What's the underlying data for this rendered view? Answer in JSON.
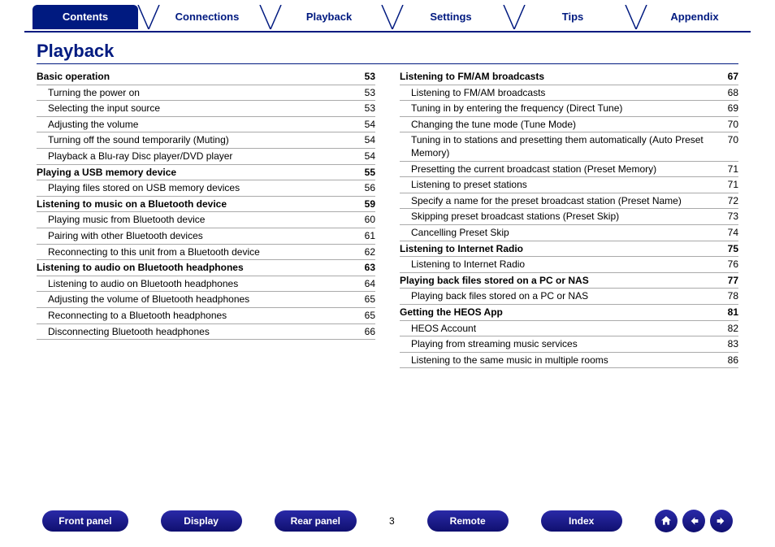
{
  "tabs": [
    {
      "label": "Contents",
      "active": true
    },
    {
      "label": "Connections",
      "active": false
    },
    {
      "label": "Playback",
      "active": false
    },
    {
      "label": "Settings",
      "active": false
    },
    {
      "label": "Tips",
      "active": false
    },
    {
      "label": "Appendix",
      "active": false
    }
  ],
  "heading": "Playback",
  "left": [
    {
      "label": "Basic operation",
      "page": "53",
      "section": true
    },
    {
      "label": "Turning the power on",
      "page": "53",
      "section": false
    },
    {
      "label": "Selecting the input source",
      "page": "53",
      "section": false
    },
    {
      "label": "Adjusting the volume",
      "page": "54",
      "section": false
    },
    {
      "label": "Turning off the sound temporarily (Muting)",
      "page": "54",
      "section": false
    },
    {
      "label": "Playback a Blu-ray Disc player/DVD player",
      "page": "54",
      "section": false
    },
    {
      "label": "Playing a USB memory device",
      "page": "55",
      "section": true
    },
    {
      "label": "Playing files stored on USB memory devices",
      "page": "56",
      "section": false
    },
    {
      "label": "Listening to music on a Bluetooth device",
      "page": "59",
      "section": true
    },
    {
      "label": "Playing music from Bluetooth device",
      "page": "60",
      "section": false
    },
    {
      "label": "Pairing with other Bluetooth devices",
      "page": "61",
      "section": false
    },
    {
      "label": "Reconnecting to this unit from a Bluetooth device",
      "page": "62",
      "section": false
    },
    {
      "label": "Listening to audio on Bluetooth headphones",
      "page": "63",
      "section": true
    },
    {
      "label": "Listening to audio on Bluetooth headphones",
      "page": "64",
      "section": false
    },
    {
      "label": "Adjusting the volume of Bluetooth headphones",
      "page": "65",
      "section": false
    },
    {
      "label": "Reconnecting to a Bluetooth headphones",
      "page": "65",
      "section": false
    },
    {
      "label": "Disconnecting Bluetooth headphones",
      "page": "66",
      "section": false
    }
  ],
  "right": [
    {
      "label": "Listening to FM/AM broadcasts",
      "page": "67",
      "section": true
    },
    {
      "label": "Listening to FM/AM broadcasts",
      "page": "68",
      "section": false
    },
    {
      "label": "Tuning in by entering the frequency (Direct Tune)",
      "page": "69",
      "section": false
    },
    {
      "label": "Changing the tune mode (Tune Mode)",
      "page": "70",
      "section": false
    },
    {
      "label": "Tuning in to stations and presetting them automatically (Auto Preset Memory)",
      "page": "70",
      "section": false
    },
    {
      "label": "Presetting the current broadcast station (Preset Memory)",
      "page": "71",
      "section": false
    },
    {
      "label": "Listening to preset stations",
      "page": "71",
      "section": false
    },
    {
      "label": "Specify a name for the preset broadcast station (Preset Name)",
      "page": "72",
      "section": false
    },
    {
      "label": "Skipping preset broadcast stations (Preset Skip)",
      "page": "73",
      "section": false
    },
    {
      "label": "Cancelling Preset Skip",
      "page": "74",
      "section": false
    },
    {
      "label": "Listening to Internet Radio",
      "page": "75",
      "section": true
    },
    {
      "label": "Listening to Internet Radio",
      "page": "76",
      "section": false
    },
    {
      "label": "Playing back files stored on a PC or NAS",
      "page": "77",
      "section": true
    },
    {
      "label": "Playing back files stored on a PC or NAS",
      "page": "78",
      "section": false
    },
    {
      "label": "Getting the HEOS App",
      "page": "81",
      "section": true
    },
    {
      "label": "HEOS Account",
      "page": "82",
      "section": false
    },
    {
      "label": "Playing from streaming music services",
      "page": "83",
      "section": false
    },
    {
      "label": "Listening to the same music in multiple rooms",
      "page": "86",
      "section": false
    }
  ],
  "bottom": {
    "buttons": [
      "Front panel",
      "Display",
      "Rear panel",
      "Remote",
      "Index"
    ],
    "page": "3"
  }
}
